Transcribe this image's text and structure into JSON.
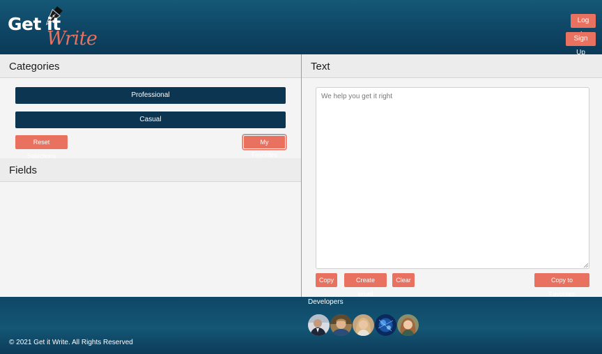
{
  "header": {
    "logo": {
      "line1": "Get it",
      "line2": "Write"
    },
    "login_label": "Log In",
    "signup_label": "Sign Up"
  },
  "categories": {
    "title": "Categories",
    "items": [
      "Professional",
      "Casual"
    ],
    "reset_label": "Reset Selections",
    "favorites_label": "My Favorites"
  },
  "fields": {
    "title": "Fields"
  },
  "text_panel": {
    "title": "Text",
    "placeholder": "We help you get it right",
    "copy_label": "Copy",
    "email_label": "Create email",
    "clear_label": "Clear",
    "copy_fav_label": "Copy to Favorites"
  },
  "footer": {
    "developers_label": "Developers",
    "copyright": "© 2021 Get it Write. All Rights Reserved",
    "avatars": [
      "developer-avatar-1",
      "developer-avatar-2",
      "developer-avatar-3",
      "developer-avatar-4",
      "developer-avatar-5"
    ]
  },
  "colors": {
    "header_bg": "#0f4766",
    "accent": "#e8715f",
    "category_button": "#0c3552",
    "panel_bg": "#f4f4f4"
  }
}
